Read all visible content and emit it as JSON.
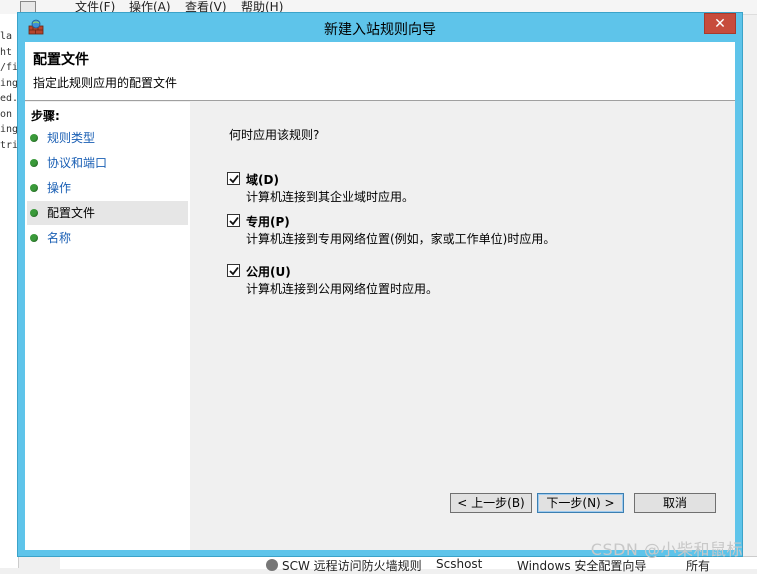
{
  "background": {
    "menu": [
      "文件(F)",
      "操作(A)",
      "查看(V)",
      "帮助(H)"
    ],
    "code_lines": [
      "la",
      "ht",
      "/fi",
      "ing",
      "ed.",
      "on",
      "ing",
      "tri"
    ],
    "bottom_row": [
      "SCW 远程访问防火墙规则",
      "Scshost",
      "Windows 安全配置向导",
      "所有"
    ],
    "watermark": "CSDN @小柴和鼠标"
  },
  "dialog": {
    "title": "新建入站规则向导",
    "close_glyph": "✕",
    "header_title": "配置文件",
    "header_subtitle": "指定此规则应用的配置文件"
  },
  "steps": {
    "title": "步骤:",
    "items": [
      "规则类型",
      "协议和端口",
      "操作",
      "配置文件",
      "名称"
    ],
    "current_index": 3
  },
  "content": {
    "question": "何时应用该规则?",
    "options": [
      {
        "label": "域(D)",
        "description": "计算机连接到其企业域时应用。",
        "checked": true
      },
      {
        "label": "专用(P)",
        "description": "计算机连接到专用网络位置(例如，家或工作单位)时应用。",
        "checked": true
      },
      {
        "label": "公用(U)",
        "description": "计算机连接到公用网络位置时应用。",
        "checked": true
      }
    ]
  },
  "buttons": {
    "back": "< 上一步(B)",
    "next": "下一步(N) >",
    "cancel": "取消"
  }
}
